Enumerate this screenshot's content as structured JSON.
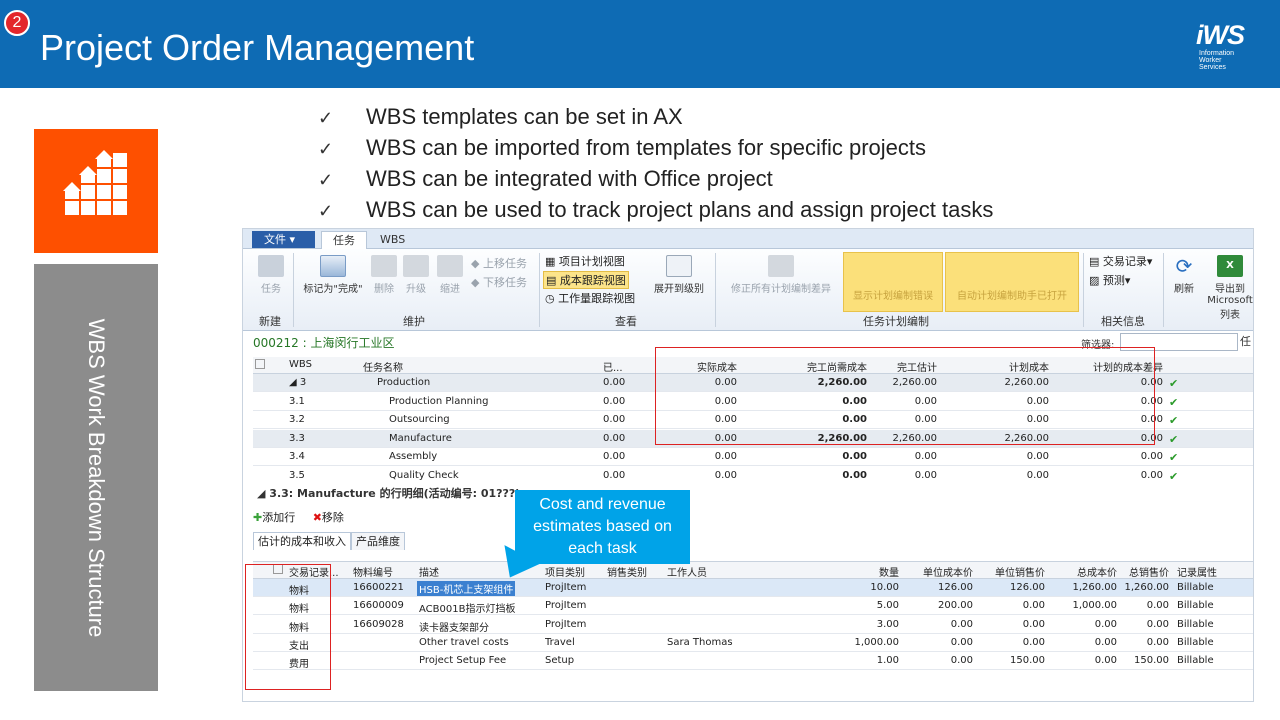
{
  "slide": {
    "number": "2",
    "title": "Project Order Management",
    "logo_text": "iWS",
    "logo_sub": [
      "Information",
      "Worker",
      "Services"
    ],
    "side_label": "WBS Work Breakdown Structure",
    "bullets": [
      "WBS templates can be set in AX",
      "WBS can be imported from templates for specific projects",
      "WBS can be integrated with Office project",
      "WBS can be used to track project plans and assign project tasks"
    ],
    "check_glyph": "✓",
    "callout": "Cost and revenue estimates based on each task",
    "colors": {
      "header": "#0e6bb4",
      "orange": "#fe5000",
      "gray": "#8c8c8c",
      "callout": "#00a3e8"
    }
  },
  "app": {
    "file_tab": "文件",
    "tabs": [
      "任务",
      "WBS"
    ],
    "ribbon": {
      "new_group": {
        "label": "新建",
        "button": "任务"
      },
      "maintain_group": {
        "label": "维护",
        "mark_complete": "标记为\"完成\"",
        "delete": "删除",
        "promote": "升级",
        "demote": "缩进",
        "move_up": "上移任务",
        "move_down": "下移任务"
      },
      "view_group": {
        "label": "查看",
        "items": [
          "项目计划视图",
          "成本跟踪视图",
          "工作量跟踪视图"
        ],
        "expand": "展开到级别"
      },
      "fix_errors": "修正所有计划编制差异",
      "planning_group": {
        "label": "任务计划编制",
        "show_errors": "显示计划编制错误",
        "auto_open": "自动计划编制助手已打开"
      },
      "related_group": {
        "label": "相关信息",
        "transactions": "交易记录",
        "forecast": "预测"
      },
      "refresh": "刷新",
      "export": {
        "line1": "导出到",
        "line2": "Microsoft",
        "line3": "列表"
      }
    },
    "project_crumb": "000212 : 上海闵行工业区",
    "filter_label": "筛选器:",
    "filter_tail": "任",
    "wbs_grid": {
      "headers": [
        "WBS",
        "任务名称",
        "已...",
        "实际成本",
        "完工尚需成本",
        "完工估计",
        "计划成本",
        "计划的成本差异"
      ],
      "rows": [
        {
          "wbs": "◢ 3",
          "name": "Production",
          "done": "0.00",
          "actual": "0.00",
          "etc": "2,260.00",
          "eac": "2,260.00",
          "planned": "2,260.00",
          "variance": "0.00"
        },
        {
          "wbs": "3.1",
          "name": "Production Planning",
          "done": "0.00",
          "actual": "0.00",
          "etc": "0.00",
          "eac": "0.00",
          "planned": "0.00",
          "variance": "0.00"
        },
        {
          "wbs": "3.2",
          "name": "Outsourcing",
          "done": "0.00",
          "actual": "0.00",
          "etc": "0.00",
          "eac": "0.00",
          "planned": "0.00",
          "variance": "0.00"
        },
        {
          "wbs": "3.3",
          "name": "Manufacture",
          "done": "0.00",
          "actual": "0.00",
          "etc": "2,260.00",
          "eac": "2,260.00",
          "planned": "2,260.00",
          "variance": "0.00"
        },
        {
          "wbs": "3.4",
          "name": "Assembly",
          "done": "0.00",
          "actual": "0.00",
          "etc": "0.00",
          "eac": "0.00",
          "planned": "0.00",
          "variance": "0.00"
        },
        {
          "wbs": "3.5",
          "name": "Quality Check",
          "done": "0.00",
          "actual": "0.00",
          "etc": "0.00",
          "eac": "0.00",
          "planned": "0.00",
          "variance": "0.00"
        }
      ]
    },
    "lines_section": "◢  3.3: Manufacture 的行明细(活动编号: 01???)",
    "add_line": "添加行",
    "remove": "移除",
    "subtabs": [
      "估计的成本和收入",
      "产品维度"
    ],
    "lines_grid": {
      "headers": [
        "交易记录...",
        "物料编号",
        "描述",
        "项目类别",
        "销售类别",
        "工作人员",
        "数量",
        "单位成本价",
        "单位销售价",
        "总成本价",
        "总销售价",
        "记录属性"
      ],
      "rows": [
        {
          "type": "物料",
          "item": "16600221",
          "desc": "HSB-机芯上支架组件",
          "cat": "ProjItem",
          "sales": "",
          "worker": "",
          "qty": "10.00",
          "ucost": "126.00",
          "usale": "126.00",
          "tcost": "1,260.00",
          "tsale": "1,260.00",
          "attr": "Billable"
        },
        {
          "type": "物料",
          "item": "16600009",
          "desc": "ACB001B指示灯挡板",
          "cat": "ProjItem",
          "sales": "",
          "worker": "",
          "qty": "5.00",
          "ucost": "200.00",
          "usale": "0.00",
          "tcost": "1,000.00",
          "tsale": "0.00",
          "attr": "Billable"
        },
        {
          "type": "物料",
          "item": "16609028",
          "desc": "读卡器支架部分",
          "cat": "ProjItem",
          "sales": "",
          "worker": "",
          "qty": "3.00",
          "ucost": "0.00",
          "usale": "0.00",
          "tcost": "0.00",
          "tsale": "0.00",
          "attr": "Billable"
        },
        {
          "type": "支出",
          "item": "",
          "desc": "Other travel costs",
          "cat": "Travel",
          "sales": "",
          "worker": "Sara Thomas",
          "qty": "1,000.00",
          "ucost": "0.00",
          "usale": "0.00",
          "tcost": "0.00",
          "tsale": "0.00",
          "attr": "Billable"
        },
        {
          "type": "费用",
          "item": "",
          "desc": "Project Setup Fee",
          "cat": "Setup",
          "sales": "",
          "worker": "",
          "qty": "1.00",
          "ucost": "0.00",
          "usale": "150.00",
          "tcost": "0.00",
          "tsale": "150.00",
          "attr": "Billable"
        }
      ]
    }
  }
}
